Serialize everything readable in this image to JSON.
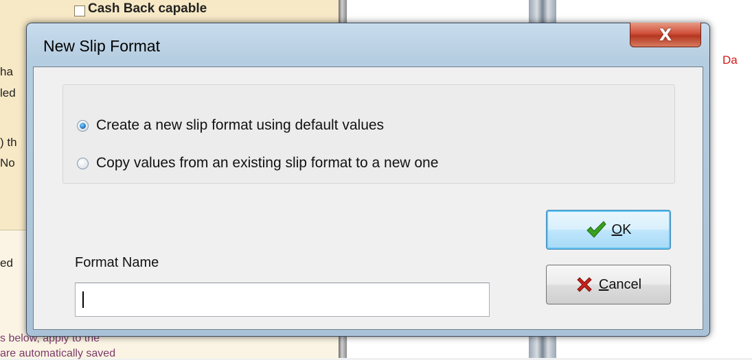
{
  "dialog": {
    "title": "New Slip Format",
    "close_label": "X",
    "options": [
      {
        "label": "Create a new slip format using default values",
        "checked": true
      },
      {
        "label": "Copy values from an existing slip format to a new one",
        "checked": false
      }
    ],
    "format_name_label": "Format Name",
    "format_name_value": "",
    "ok_mnemonic": "O",
    "ok_rest": "K",
    "cancel_mnemonic": "C",
    "cancel_rest": "ancel"
  },
  "background": {
    "checkbox_label": "Cash Back capable",
    "left_fragments": [
      "ha",
      "led",
      ") th",
      "No",
      "ed"
    ],
    "bottom_lines": [
      "s below, apply to the",
      "are automatically saved"
    ],
    "right_fragment": "Da"
  },
  "colors": {
    "ok_check": "#3aa020",
    "cancel_x": "#c8221a",
    "accent_red_text": "#d01818"
  },
  "icons": {
    "ok": "check-icon",
    "cancel": "x-icon",
    "radio_checked": "radio-checked",
    "radio_unchecked": "radio-unchecked"
  }
}
